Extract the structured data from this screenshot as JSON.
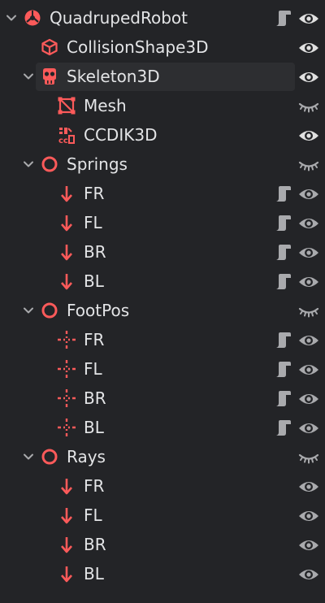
{
  "scene_tree": {
    "nodes": [
      {
        "label": "QuadrupedRobot",
        "icon": "robot-node-icon",
        "expanded": true,
        "has_script": true,
        "visible": true
      },
      {
        "label": "CollisionShape3D",
        "icon": "collision-shape-icon",
        "has_script": false,
        "visible": true
      },
      {
        "label": "Skeleton3D",
        "icon": "skeleton-icon",
        "expanded": true,
        "selected": true,
        "has_script": false,
        "visible": true
      },
      {
        "label": "Mesh",
        "icon": "mesh-icon",
        "has_script": false,
        "visible": false
      },
      {
        "label": "CCDIK3D",
        "icon": "ccdik-icon",
        "has_script": false,
        "visible": true
      },
      {
        "label": "Springs",
        "icon": "node3d-circle-icon",
        "expanded": true,
        "has_script": false,
        "visible": false
      },
      {
        "label": "FR",
        "icon": "down-arrow-icon",
        "has_script": true,
        "visible": true
      },
      {
        "label": "FL",
        "icon": "down-arrow-icon",
        "has_script": true,
        "visible": true
      },
      {
        "label": "BR",
        "icon": "down-arrow-icon",
        "has_script": true,
        "visible": true
      },
      {
        "label": "BL",
        "icon": "down-arrow-icon",
        "has_script": true,
        "visible": true
      },
      {
        "label": "FootPos",
        "icon": "node3d-circle-icon",
        "expanded": true,
        "has_script": false,
        "visible": false
      },
      {
        "label": "FR",
        "icon": "marker-icon",
        "has_script": true,
        "visible": true
      },
      {
        "label": "FL",
        "icon": "marker-icon",
        "has_script": true,
        "visible": true
      },
      {
        "label": "BR",
        "icon": "marker-icon",
        "has_script": true,
        "visible": true
      },
      {
        "label": "BL",
        "icon": "marker-icon",
        "has_script": true,
        "visible": true
      },
      {
        "label": "Rays",
        "icon": "node3d-circle-icon",
        "expanded": true,
        "has_script": false,
        "visible": false
      },
      {
        "label": "FR",
        "icon": "down-arrow-icon",
        "has_script": false,
        "visible": true
      },
      {
        "label": "FL",
        "icon": "down-arrow-icon",
        "has_script": false,
        "visible": true
      },
      {
        "label": "BR",
        "icon": "down-arrow-icon",
        "has_script": false,
        "visible": true
      },
      {
        "label": "BL",
        "icon": "down-arrow-icon",
        "has_script": false,
        "visible": true
      }
    ]
  },
  "colors": {
    "background": "#232427",
    "selected_row": "#2d2e31",
    "node_icon": "#fc5a5a",
    "text": "#e3e4e6",
    "muted_icon": "#a9aaad",
    "eye_icon": "#e0e0e0"
  }
}
